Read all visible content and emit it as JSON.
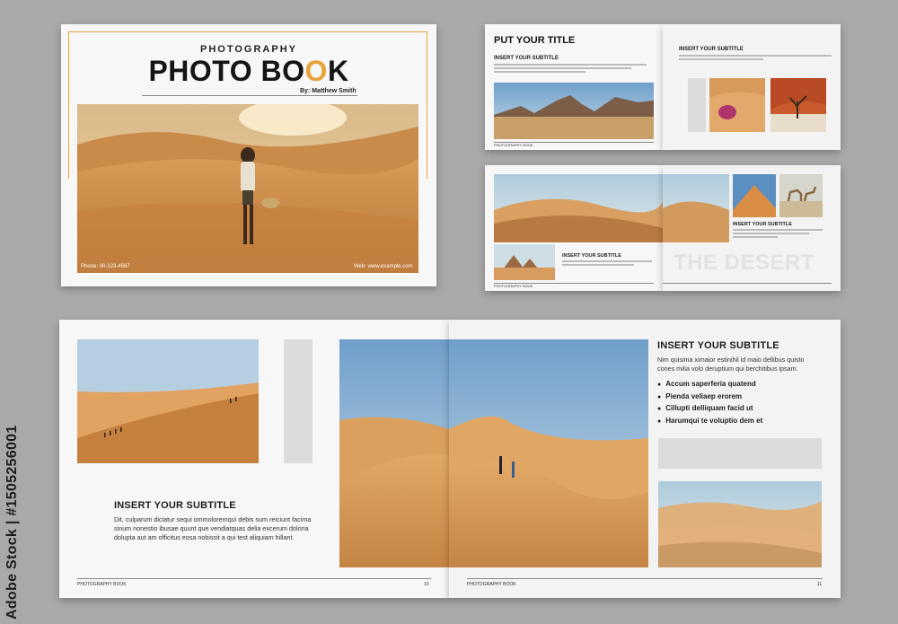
{
  "cover": {
    "kicker": "PHOTOGRAPHY",
    "title_part1": "PHOTO BO",
    "title_accent": "O",
    "title_part2": "K",
    "author": "By: Matthew Smith",
    "phone": "Phone: 00-123-4567",
    "web": "Web: www.example.com"
  },
  "spread1": {
    "title": "PUT YOUR TITLE",
    "left_subtitle": "INSERT YOUR SUBTITLE",
    "right_subtitle": "INSERT YOUR SUBTITLE",
    "footer_label": "PHOTOGRAPHY BOOK"
  },
  "spread2": {
    "subtitle_a": "INSERT YOUR SUBTITLE",
    "subtitle_b": "INSERT YOUR SUBTITLE",
    "headline": "THE DESERT",
    "footer_label": "PHOTOGRAPHY BOOK"
  },
  "spread3": {
    "left_subtitle": "INSERT YOUR SUBTITLE",
    "left_body": "Dit, culparum diciatur sequi ommoloremqui debis sum reiciunt facima sinum nonestio ibusae quunt que vendiatquas delia excerum doloria dolupta aut am officitus eosa nobissit a qui test aliquiam hillant.",
    "right_subtitle": "INSERT YOUR SUBTITLE",
    "right_body": "Nim quisima ximaior estinihil id maio dellibus quisto cones milia volo deruptium qui berchitibus ipsam.",
    "bullets": [
      "Accum saperferia quatend",
      "Pienda veliaep erorem",
      "Cillupti delliquam facid ut",
      "Harumqui te voluptio dem et"
    ],
    "footer_left_label": "PHOTOGRAPHY BOOK",
    "footer_left_page": "10",
    "footer_right_label": "PHOTOGRAPHY BOOK",
    "footer_right_page": "11"
  },
  "side_watermark": "Adobe Stock | #1505256001",
  "colors": {
    "accent": "#e8a23a",
    "background": "#a9a9a9",
    "paper": "#f7f7f7"
  }
}
